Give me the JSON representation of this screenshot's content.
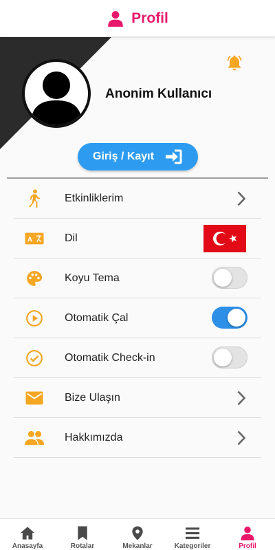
{
  "header": {
    "title": "Profil",
    "icon": "person-icon",
    "color": "#e8196b"
  },
  "profile": {
    "username": "Anonim Kullanıcı",
    "avatar_icon": "user-avatar-icon",
    "notification_icon": "bell-icon",
    "login_button": {
      "label": "Giriş / Kayıt",
      "icon": "login-arrow-icon"
    }
  },
  "settings": [
    {
      "label": "Etkinliklerim",
      "icon": "walking-person-icon",
      "control": "chevron"
    },
    {
      "label": "Dil",
      "icon": "translate-icon",
      "control": "flag",
      "value": "tr"
    },
    {
      "label": "Koyu Tema",
      "icon": "palette-icon",
      "control": "toggle",
      "on": false
    },
    {
      "label": "Otomatik Çal",
      "icon": "play-circle-icon",
      "control": "toggle",
      "on": true
    },
    {
      "label": "Otomatik Check-in",
      "icon": "check-circle-icon",
      "control": "toggle",
      "on": false
    },
    {
      "label": "Bize Ulaşın",
      "icon": "mail-icon",
      "control": "chevron"
    },
    {
      "label": "Hakkımızda",
      "icon": "people-icon",
      "control": "chevron"
    }
  ],
  "bottom_nav": [
    {
      "label": "Anasayfa",
      "icon": "home-icon",
      "active": false
    },
    {
      "label": "Rotalar",
      "icon": "bookmark-icon",
      "active": false
    },
    {
      "label": "Mekanlar",
      "icon": "location-pin-icon",
      "active": false
    },
    {
      "label": "Kategoriler",
      "icon": "menu-lines-icon",
      "active": false
    },
    {
      "label": "Profil",
      "icon": "person-icon",
      "active": true
    }
  ],
  "colors": {
    "accent": "#e8196b",
    "primary": "#2d9cf0",
    "icon_orange": "#f5a623",
    "dark": "#2b2b2b"
  }
}
